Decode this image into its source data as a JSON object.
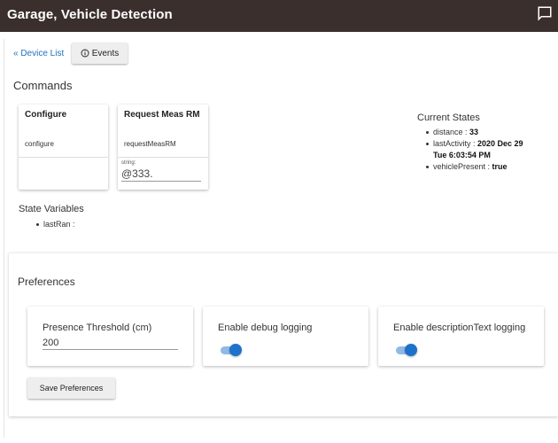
{
  "header": {
    "title": "Garage, Vehicle Detection",
    "chat_icon": "chat-bubble-icon"
  },
  "nav": {
    "device_list_label": "« Device List",
    "events_label": "Events",
    "events_icon": "info-circle-icon"
  },
  "commands": {
    "heading": "Commands",
    "items": [
      {
        "title": "Configure",
        "name": "configure"
      },
      {
        "title": "Request Meas RM",
        "name": "requestMeasRM",
        "arg_label": "string:",
        "arg_value": "@333."
      }
    ]
  },
  "current_states": {
    "heading": "Current States",
    "items": [
      {
        "key": "distance : ",
        "value": "33"
      },
      {
        "key": "lastActivity : ",
        "value": "2020 Dec 29",
        "value2": "Tue 6:03:54 PM"
      },
      {
        "key": "vehiclePresent : ",
        "value": "true"
      }
    ]
  },
  "state_variables": {
    "heading": "State Variables",
    "items": [
      {
        "label": "lastRan :"
      }
    ]
  },
  "preferences": {
    "heading": "Preferences",
    "items": [
      {
        "label": "Presence Threshold (cm)",
        "value": "200"
      },
      {
        "label": "Enable debug logging",
        "enabled": true
      },
      {
        "label": "Enable descriptionText logging",
        "enabled": true
      }
    ],
    "save_label": "Save Preferences"
  },
  "colors": {
    "header_bg": "#3a2f2c",
    "link": "#1e73be",
    "toggle_on": "#1f72c9"
  }
}
